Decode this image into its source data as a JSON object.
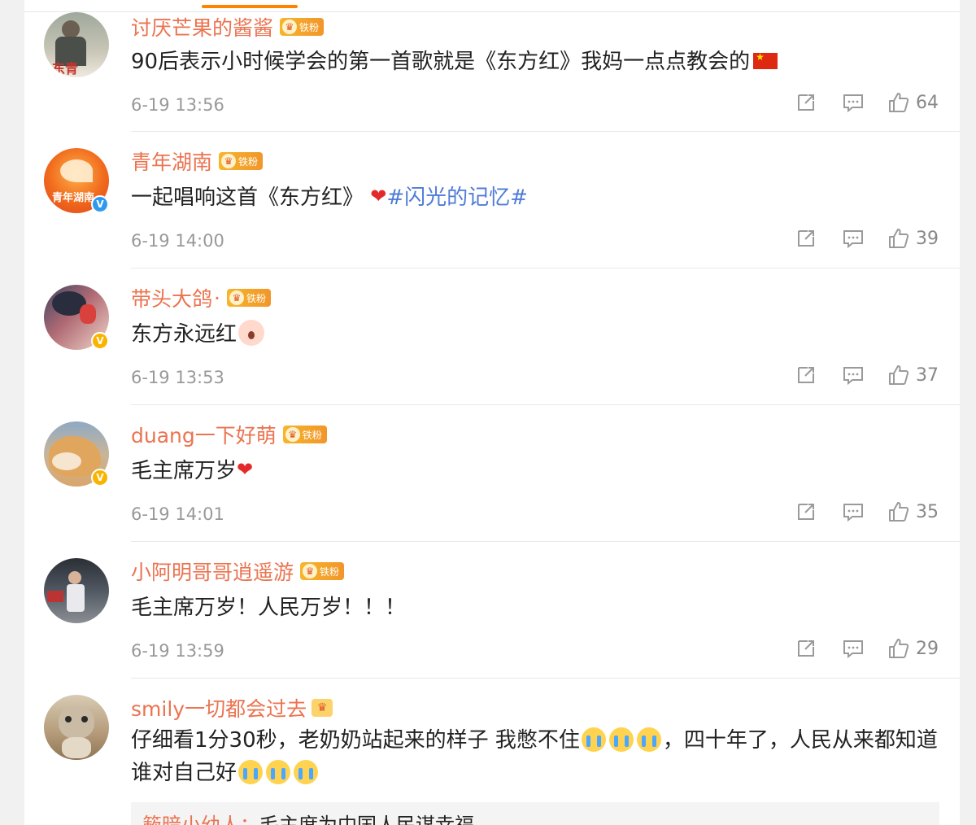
{
  "comments": [
    {
      "name": "讨厌芒果的酱酱",
      "badge": "铁粉",
      "text_before": "90后表示小时候学会的第一首歌就是《东方红》我妈一点点教会的",
      "time": "6-19 13:56",
      "likes": "64",
      "avatar_text": "东青"
    },
    {
      "name": "青年湖南",
      "badge": "铁粉",
      "text_before": "一起唱响这首《东方红》",
      "hashtag": "#闪光的记忆#",
      "time": "6-19 14:00",
      "likes": "39",
      "avatar_text": "青年湖南"
    },
    {
      "name": "带头大鸽",
      "name_suffix": "·",
      "badge": "铁粉",
      "text_before": "东方永远红",
      "time": "6-19 13:53",
      "likes": "37"
    },
    {
      "name": "duang一下好萌",
      "badge": "铁粉",
      "text_before": "毛主席万岁",
      "time": "6-19 14:01",
      "likes": "35"
    },
    {
      "name": "小阿明哥哥逍遥游",
      "badge": "铁粉",
      "text_before": "毛主席万岁！人民万岁！！！",
      "time": "6-19 13:59",
      "likes": "29"
    },
    {
      "name": "smily一切都会过去",
      "text_part1": "仔细看1分30秒，老奶奶站起来的样子 我憋不住",
      "text_part2": "，四十年了，人民从来都知道谁对自己好"
    }
  ],
  "reply_preview": {
    "name": "簌暗小幼人：",
    "text": "毛主席为中国人民谋幸福"
  },
  "icons": {
    "repost": "repost-icon",
    "comment": "comment-icon",
    "like": "like-icon",
    "verified": "verified-icon",
    "fan_crown": "crown-icon"
  },
  "colors": {
    "username": "#eb7350",
    "hashtag": "#4f7bd6",
    "accent": "#ff8200",
    "meta": "#999999"
  }
}
